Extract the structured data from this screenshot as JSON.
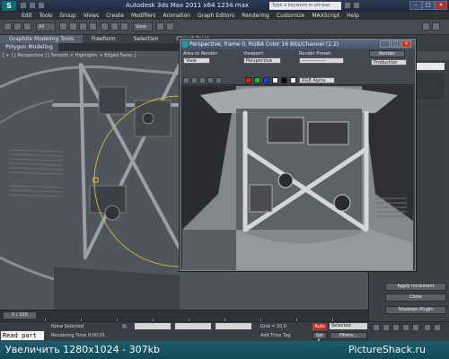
{
  "titlebar": {
    "title": "Autodesk 3ds Max   2011 x64     1234.max",
    "search_placeholder": "Type a keyword or phrase",
    "logo_glyph": "S"
  },
  "menu": [
    "Edit",
    "Tools",
    "Group",
    "Views",
    "Create",
    "Modifiers",
    "Animation",
    "Graph Editors",
    "Rendering",
    "Customize",
    "MAXScript",
    "Help"
  ],
  "toolbar": {
    "selection_filter": "All",
    "view_select": "View"
  },
  "ribbon": {
    "tabs": [
      "Graphite Modeling Tools",
      "Freeform",
      "Selection",
      "Object Paint"
    ],
    "sub_label": "Polygon Modeling"
  },
  "viewport": {
    "label": "[ + ] [ Perspective ] [ Smooth + Highlights + Edged Faces ]"
  },
  "render_window": {
    "title": "Perspective, frame 0, RGBA Color 16 Bits/Channel (1:2)",
    "area_label": "Area to Render:",
    "area_value": "View",
    "viewport_label": "Viewport:",
    "viewport_value": "Perspective",
    "preset_label": "Render Preset:",
    "preset_value": "---------------",
    "render_button": "Render",
    "production_value": "Production",
    "channel_value": "RGB Alpha",
    "colors": {
      "red": "#e02020",
      "green": "#20c020",
      "blue": "#2040e0",
      "white": "#f0f0f0",
      "black": "#101010"
    }
  },
  "command_panel": {
    "apply_increment": "Apply increment",
    "close": "Close",
    "shadows_plugin": "Shadows Plugin"
  },
  "timeline": {
    "frame_counter": "0 / 100"
  },
  "status": {
    "selection": "None Selected",
    "render_time": "Rendering Time 0:00:01",
    "grid": "Grid = 10,0",
    "add_time_tag": "Add Time Tag",
    "auto_key": "Auto",
    "selected_dropdown": "Selected",
    "set_key": "Set K.",
    "filters": "Filters..."
  },
  "stamp": "Read part",
  "watermark": {
    "left": "Увеличить   1280x1024 - 307kb",
    "right": "PictureShack.ru"
  }
}
